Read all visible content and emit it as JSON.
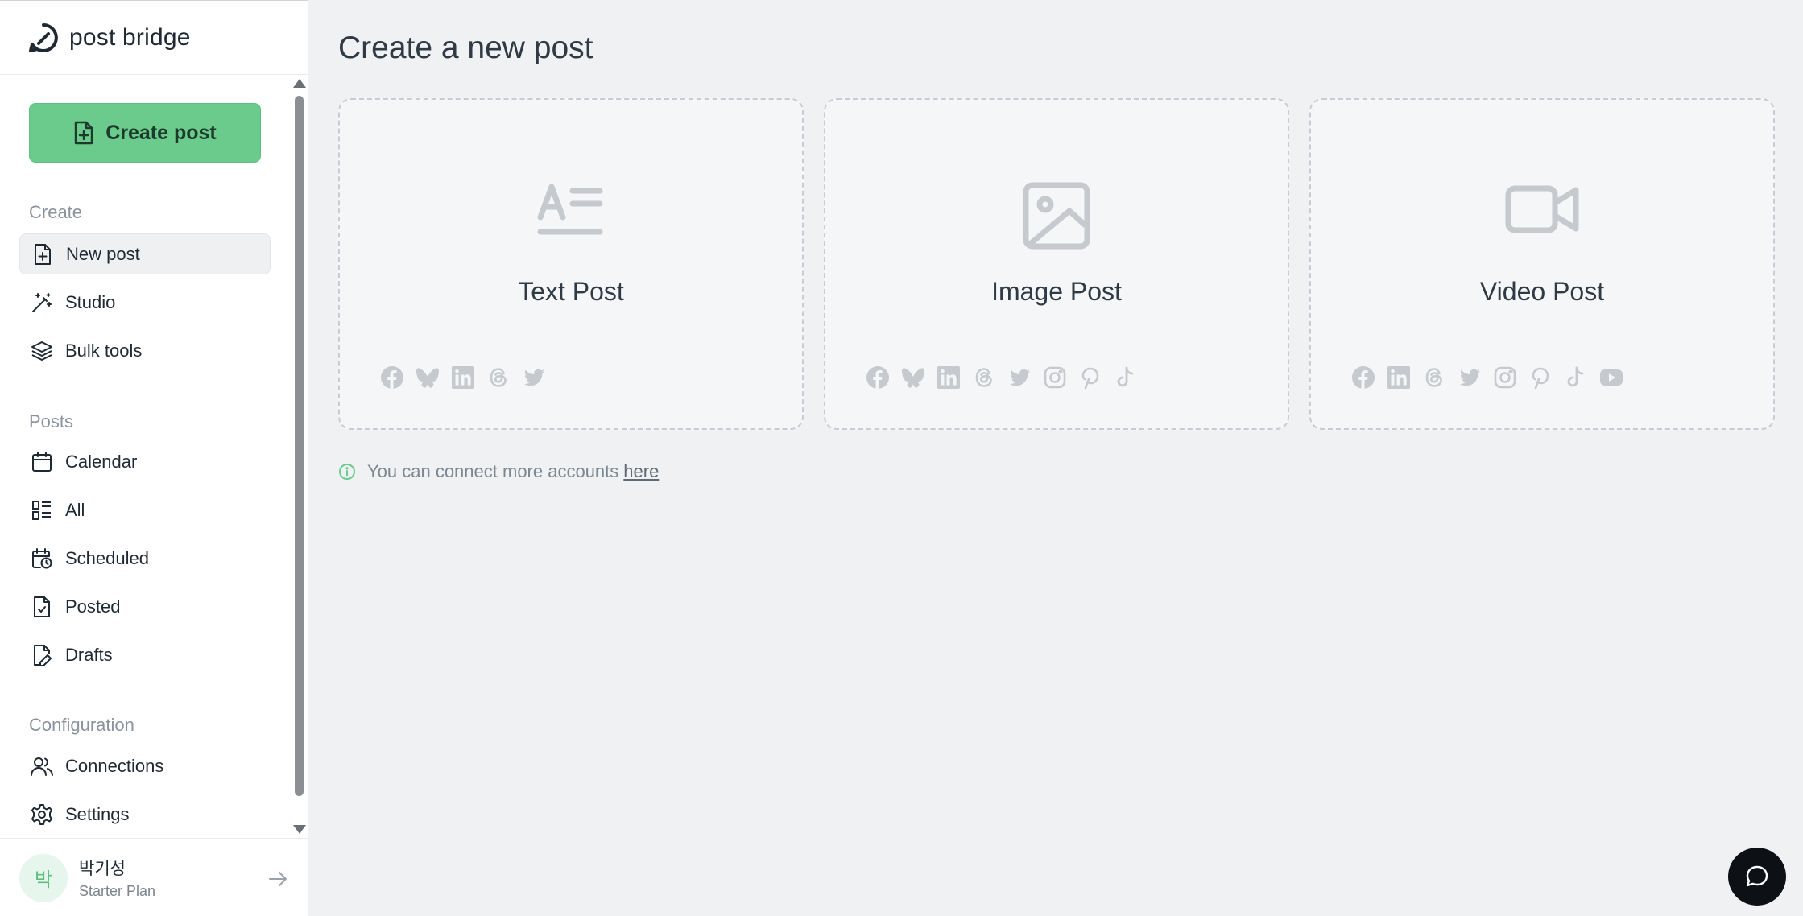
{
  "app": {
    "name": "post bridge"
  },
  "sidebar": {
    "create_button": "Create post",
    "sections": {
      "create": "Create",
      "posts": "Posts",
      "configuration": "Configuration"
    },
    "items": {
      "new_post": "New post",
      "studio": "Studio",
      "bulk_tools": "Bulk tools",
      "calendar": "Calendar",
      "all": "All",
      "scheduled": "Scheduled",
      "posted": "Posted",
      "drafts": "Drafts",
      "connections": "Connections",
      "settings": "Settings"
    },
    "active_item": "New post",
    "user": {
      "initial": "박",
      "name": "박기성",
      "plan": "Starter Plan"
    }
  },
  "main": {
    "title": "Create a new post",
    "cards": [
      {
        "title": "Text Post",
        "icon": "text-icon",
        "platforms": [
          "facebook",
          "bluesky",
          "linkedin",
          "threads",
          "twitter"
        ]
      },
      {
        "title": "Image Post",
        "icon": "image-icon",
        "platforms": [
          "facebook",
          "bluesky",
          "linkedin",
          "threads",
          "twitter",
          "instagram",
          "pinterest",
          "tiktok"
        ]
      },
      {
        "title": "Video Post",
        "icon": "video-icon",
        "platforms": [
          "facebook",
          "linkedin",
          "threads",
          "twitter",
          "instagram",
          "pinterest",
          "tiktok",
          "youtube"
        ]
      }
    ],
    "info": {
      "text": "You can connect more accounts",
      "link": "here"
    }
  },
  "colors": {
    "accent": "#6acb8c",
    "background": "#f0f1f3",
    "sidebar": "#ffffff",
    "text": "#2f3a45",
    "muted_icon": "#c6c9cd"
  }
}
